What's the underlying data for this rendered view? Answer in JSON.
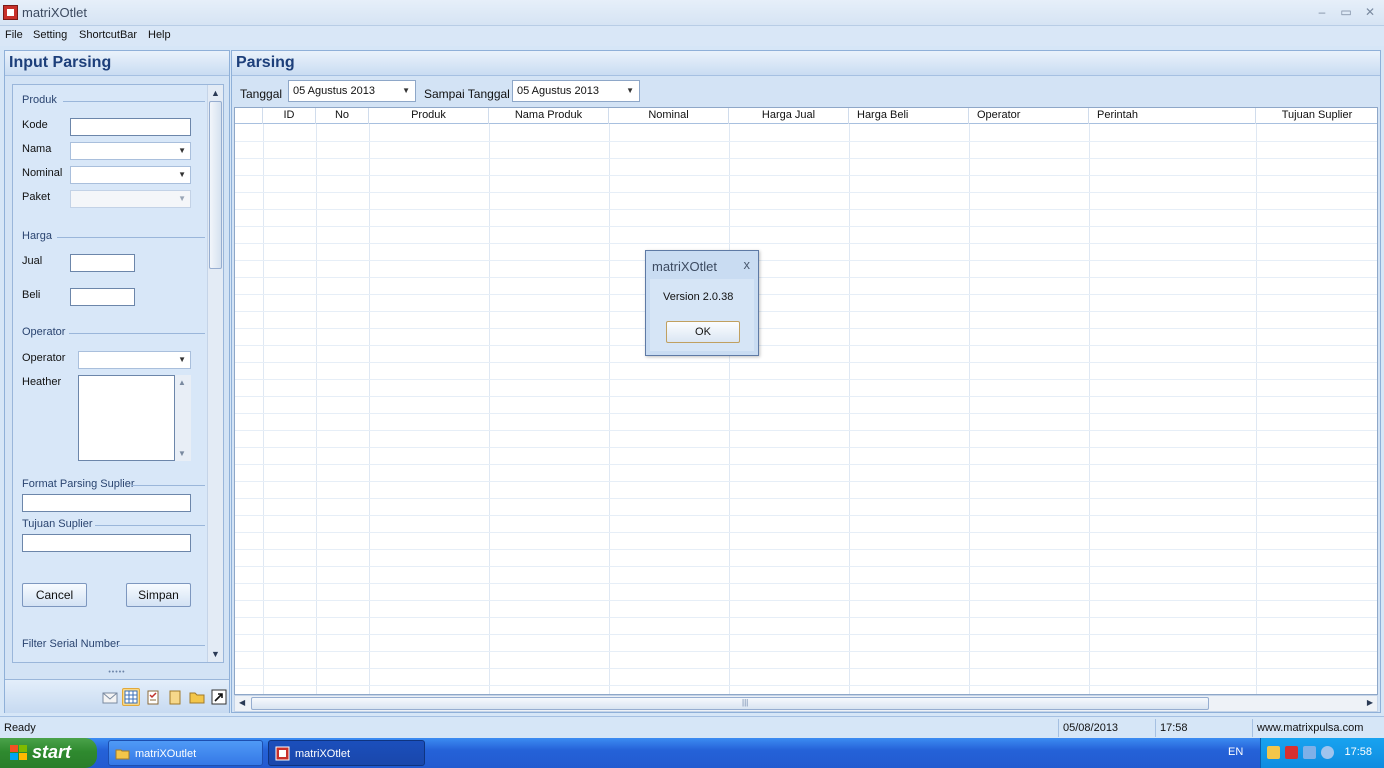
{
  "window": {
    "title": "matriXOtlet",
    "minimize": "–",
    "maximize": "▭",
    "close": "✕"
  },
  "menu": {
    "file": "File",
    "setting": "Setting",
    "shortcutbar": "ShortcutBar",
    "help": "Help"
  },
  "left_panel": {
    "title": "Input Parsing",
    "produk_group": "Produk",
    "kode_label": "Kode",
    "nama_label": "Nama",
    "nominal_label": "Nominal",
    "paket_label": "Paket",
    "harga_group": "Harga",
    "jual_label": "Jual",
    "beli_label": "Beli",
    "operator_group": "Operator",
    "operator_label": "Operator",
    "heather_label": "Heather",
    "format_parsing_label": "Format Parsing Suplier",
    "tujuan_suplier_label": "Tujuan Suplier",
    "cancel_button": "Cancel",
    "simpan_button": "Simpan",
    "filter_serial_label": "Filter Serial Number",
    "grip": "•••••"
  },
  "right_panel": {
    "title": "Parsing",
    "tanggal_label": "Tanggal",
    "tanggal_value": "05  Agustus  2013",
    "sampai_label": "Sampai Tanggal",
    "sampai_value": "05  Agustus  2013",
    "columns": [
      "",
      "ID",
      "No",
      "Produk",
      "Nama Produk",
      "Nominal",
      "Harga Jual",
      "Harga Beli",
      "Operator",
      "Perintah",
      "Tujuan Suplier"
    ]
  },
  "dialog": {
    "title": "matriXOtlet",
    "close": "x",
    "message": "Version 2.0.38",
    "ok_button": "OK"
  },
  "statusbar": {
    "status": "Ready",
    "date": "05/08/2013",
    "time": "17:58",
    "website": "www.matrixpulsa.com"
  },
  "taskbar": {
    "start_label": "start",
    "items": [
      "matriXOutlet",
      "matriXOtlet"
    ],
    "language": "EN",
    "clock": "17:58"
  },
  "colors": {
    "accent": "#1d3f7a",
    "panel_bg": "#d3e3f5",
    "taskbar": "#2562d8",
    "start_green": "#2f8a2f"
  }
}
